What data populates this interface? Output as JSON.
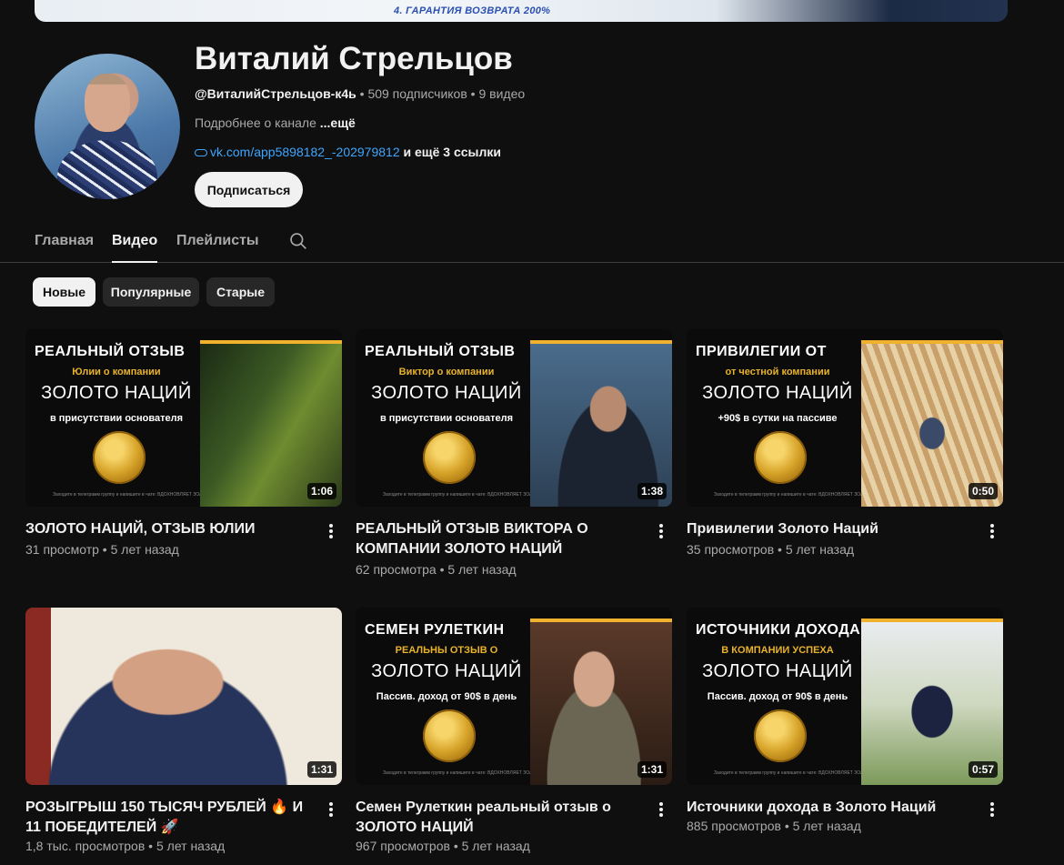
{
  "banner": {
    "text": "4. ГАРАНТИЯ ВОЗВРАТА 200%"
  },
  "channel": {
    "title": "Виталий Стрельцов",
    "handle": "@ВиталийСтрельцов-к4ь",
    "subscribers": "509 подписчиков",
    "videos": "9 видео",
    "about": "Подробнее о канале",
    "about_more": "...ещё",
    "link": "vk.com/app5898182_-202979812",
    "link_extra": "и ещё 3 ссылки",
    "subscribe_label": "Подписаться"
  },
  "tabs": [
    "Главная",
    "Видео",
    "Плейлисты"
  ],
  "active_tab": "Видео",
  "chips": [
    "Новые",
    "Популярные",
    "Старые"
  ],
  "active_chip": "Новые",
  "videos": [
    {
      "title": "ЗОЛОТО НАЦИЙ, ОТЗЫВ ЮЛИИ",
      "views": "31 просмотр",
      "age": "5 лет назад",
      "duration": "1:06",
      "thumb": {
        "line1": "РЕАЛЬНЫЙ ОТЗЫВ",
        "line2": "Юлии о компании",
        "line3": "ЗОЛОТО НАЦИЙ",
        "line4": "в присутствии основателя",
        "tiny": "Заходите в телеграмм группу и напишите в чате: ВДОХНОВЛЯЕТ ЗОЛОТО НАЦИЙ"
      }
    },
    {
      "title": "РЕАЛЬНЫЙ ОТЗЫВ ВИКТОРА О КОМПАНИИ ЗОЛОТО НАЦИЙ",
      "views": "62 просмотра",
      "age": "5 лет назад",
      "duration": "1:38",
      "thumb": {
        "line1": "РЕАЛЬНЫЙ ОТЗЫВ",
        "line2": "Виктор о компании",
        "line3": "ЗОЛОТО НАЦИЙ",
        "line4": "в присутствии основателя",
        "tiny": "Заходите в телеграмм группу и напишите в чате: ВДОХНОВЛЯЕТ ЗОЛОТО НАЦИЙ"
      }
    },
    {
      "title": "Привилегии Золото Наций",
      "views": "35 просмотров",
      "age": "5 лет назад",
      "duration": "0:50",
      "thumb": {
        "line1": "ПРИВИЛЕГИИ ОТ",
        "line2": "от честной компании",
        "line3": "ЗОЛОТО НАЦИЙ",
        "line4": "+90$ в сутки на пассиве",
        "tiny": "Заходите в телеграмм группу и напишите в чате: ВДОХНОВЛЯЕТ ЗОЛОТО НАЦИЙ"
      }
    },
    {
      "title": "РОЗЫГРЫШ 150 ТЫСЯЧ РУБЛЕЙ 🔥 И 11 ПОБЕДИТЕЛЕЙ 🚀",
      "views": "1,8 тыс. просмотров",
      "age": "5 лет назад",
      "duration": "1:31"
    },
    {
      "title": "Семен Рулеткин реальный отзыв о ЗОЛОТО НАЦИЙ",
      "views": "967 просмотров",
      "age": "5 лет назад",
      "duration": "1:31",
      "thumb": {
        "line1": "СЕМЕН РУЛЕТКИН",
        "line2": "РЕАЛЬНЫ ОТЗЫВ О",
        "line3": "ЗОЛОТО НАЦИЙ",
        "line4": "Пассив. доход от 90$ в день",
        "tiny": "Заходите в телеграмм группу и напишите в чате: ВДОХНОВЛЯЕТ ЗОЛОТО НАЦИЙ"
      }
    },
    {
      "title": "Источники дохода в Золото Наций",
      "views": "885 просмотров",
      "age": "5 лет назад",
      "duration": "0:57",
      "thumb": {
        "line1": "ИСТОЧНИКИ ДОХОДА",
        "line2": "В КОМПАНИИ УСПЕХА",
        "line3": "ЗОЛОТО НАЦИЙ",
        "line4": "Пассив. доход от 90$ в день",
        "tiny": "Заходите в телеграмм группу и напишите в чате: ВДОХНОВЛЯЕТ ЗОЛОТО НАЦИЙ"
      }
    }
  ],
  "colors": {
    "background": "#0f0f0f",
    "link": "#3ea6ff",
    "accent_gold": "#e8b32b"
  }
}
